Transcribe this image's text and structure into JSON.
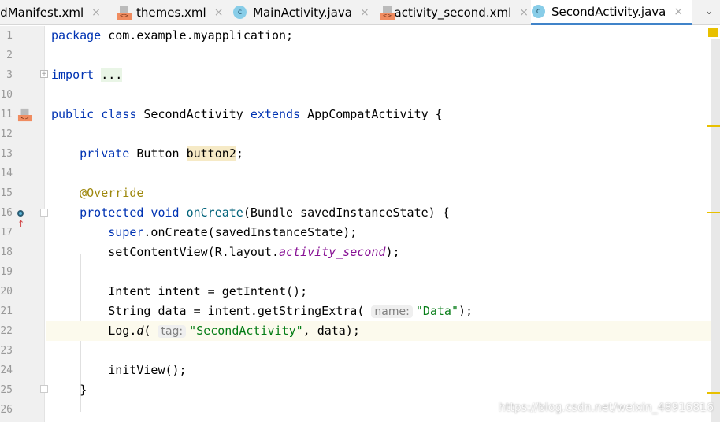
{
  "tabs": [
    {
      "label": "idManifest.xml",
      "icon": "xml-file-icon",
      "active": false
    },
    {
      "label": "themes.xml",
      "icon": "xml-file-icon",
      "active": false
    },
    {
      "label": "MainActivity.java",
      "icon": "class-icon",
      "active": false
    },
    {
      "label": "activity_second.xml",
      "icon": "xml-file-icon",
      "active": false
    },
    {
      "label": "SecondActivity.java",
      "icon": "class-icon",
      "active": true
    }
  ],
  "tab_close": "×",
  "chevron": "⌄",
  "class_letter": "c",
  "lines": [
    {
      "n": "1",
      "tokens": [
        {
          "t": "package ",
          "c": "kw"
        },
        {
          "t": "com.example.myapplication;"
        }
      ]
    },
    {
      "n": "2",
      "tokens": []
    },
    {
      "n": "3",
      "tokens": [
        {
          "t": "import ",
          "c": "kw"
        },
        {
          "t": "...",
          "c": "fold"
        }
      ]
    },
    {
      "n": "10",
      "tokens": []
    },
    {
      "n": "11",
      "tokens": [
        {
          "t": "public class ",
          "c": "kw"
        },
        {
          "t": "SecondActivity "
        },
        {
          "t": "extends ",
          "c": "kw"
        },
        {
          "t": "AppCompatActivity {"
        }
      ]
    },
    {
      "n": "12",
      "tokens": []
    },
    {
      "n": "13",
      "tokens": [
        {
          "t": "    "
        },
        {
          "t": "private ",
          "c": "kw"
        },
        {
          "t": "Button "
        },
        {
          "t": "button2",
          "c": "fldp"
        },
        {
          "t": ";"
        }
      ]
    },
    {
      "n": "14",
      "tokens": []
    },
    {
      "n": "15",
      "tokens": [
        {
          "t": "    "
        },
        {
          "t": "@Override",
          "c": "ann"
        }
      ]
    },
    {
      "n": "16",
      "tokens": [
        {
          "t": "    "
        },
        {
          "t": "protected void ",
          "c": "kw"
        },
        {
          "t": "onCreate",
          "c": "fn"
        },
        {
          "t": "(Bundle savedInstanceState) {"
        }
      ]
    },
    {
      "n": "17",
      "tokens": [
        {
          "t": "        "
        },
        {
          "t": "super",
          "c": "kw"
        },
        {
          "t": ".onCreate(savedInstanceState);"
        }
      ]
    },
    {
      "n": "18",
      "tokens": [
        {
          "t": "        setContentView(R.layout."
        },
        {
          "t": "activity_second",
          "c": "it"
        },
        {
          "t": ");"
        }
      ]
    },
    {
      "n": "19",
      "tokens": []
    },
    {
      "n": "20",
      "tokens": [
        {
          "t": "        Intent intent = getIntent();"
        }
      ]
    },
    {
      "n": "21",
      "tokens": [
        {
          "t": "        String data = intent.getStringExtra( "
        },
        {
          "t": "name:",
          "c": "hint"
        },
        {
          "t": "\"Data\"",
          "c": "str"
        },
        {
          "t": ");"
        }
      ]
    },
    {
      "n": "22",
      "current": true,
      "tokens": [
        {
          "t": "        Log."
        },
        {
          "t": "d",
          "c": "itb"
        },
        {
          "t": "( "
        },
        {
          "t": "tag:",
          "c": "hint"
        },
        {
          "t": "\"SecondActivity\"",
          "c": "str"
        },
        {
          "t": ", data);"
        }
      ]
    },
    {
      "n": "23",
      "tokens": []
    },
    {
      "n": "24",
      "tokens": [
        {
          "t": "        initView();"
        }
      ]
    },
    {
      "n": "25",
      "tokens": [
        {
          "t": "    }"
        }
      ]
    },
    {
      "n": "26",
      "tokens": []
    }
  ],
  "colors": {
    "active_tab_underline": "#4083c9",
    "keyword": "#0033b3",
    "string": "#067d17",
    "annotation": "#9e880d",
    "warning": "#e8c000"
  },
  "watermark": "https://blog.csdn.net/weixin_48916816"
}
